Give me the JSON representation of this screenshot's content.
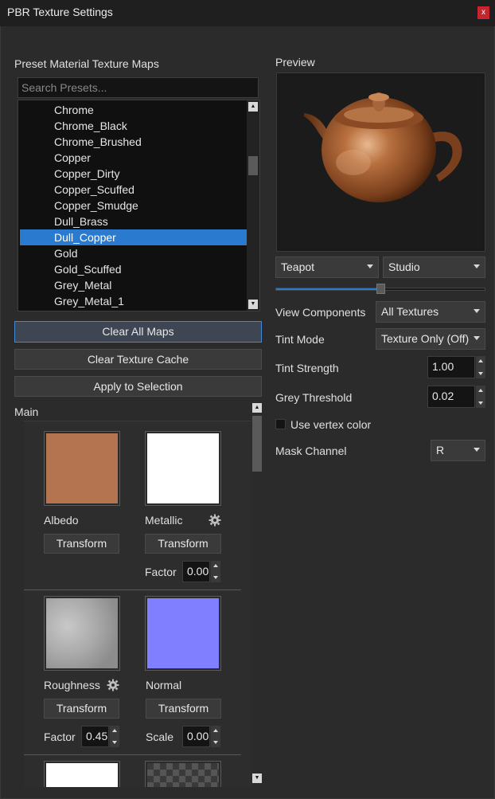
{
  "window": {
    "title": "PBR Texture Settings",
    "close_glyph": "x"
  },
  "presets": {
    "heading": "Preset Material Texture Maps",
    "search_placeholder": "Search Presets...",
    "items": [
      "Chrome",
      "Chrome_Black",
      "Chrome_Brushed",
      "Copper",
      "Copper_Dirty",
      "Copper_Scuffed",
      "Copper_Smudge",
      "Dull_Brass",
      "Dull_Copper",
      "Gold",
      "Gold_Scuffed",
      "Grey_Metal",
      "Grey_Metal_1"
    ],
    "selected": "Dull_Copper"
  },
  "actions": {
    "clear_all_maps": "Clear All Maps",
    "clear_texture_cache": "Clear Texture Cache",
    "apply_to_selection": "Apply to Selection"
  },
  "main": {
    "heading": "Main",
    "albedo": {
      "label": "Albedo",
      "transform": "Transform",
      "color": "#b3744f"
    },
    "metallic": {
      "label": "Metallic",
      "transform": "Transform",
      "factor_label": "Factor",
      "factor": "0.00",
      "color": "#ffffff",
      "icon": "gear-icon"
    },
    "roughness": {
      "label": "Roughness",
      "transform": "Transform",
      "factor_label": "Factor",
      "factor": "0.45",
      "color": "#a9a9a9",
      "icon": "gear-icon"
    },
    "normal": {
      "label": "Normal",
      "transform": "Transform",
      "scale_label": "Scale",
      "scale": "0.00",
      "color": "#7f7fff"
    }
  },
  "preview": {
    "heading": "Preview",
    "model": "Teapot",
    "environment": "Studio",
    "slider_level": 0.5
  },
  "settings": {
    "view_components_label": "View Components",
    "view_components": "All Textures",
    "tint_mode_label": "Tint Mode",
    "tint_mode": "Texture Only (Off)",
    "tint_strength_label": "Tint Strength",
    "tint_strength": "1.00",
    "grey_threshold_label": "Grey Threshold",
    "grey_threshold": "0.02",
    "use_vertex_color_label": "Use vertex color",
    "use_vertex_color": false,
    "mask_channel_label": "Mask Channel",
    "mask_channel": "R"
  },
  "colors": {
    "accent": "#2a7bd0",
    "close": "#c4262e",
    "copper": "#9a5530"
  }
}
